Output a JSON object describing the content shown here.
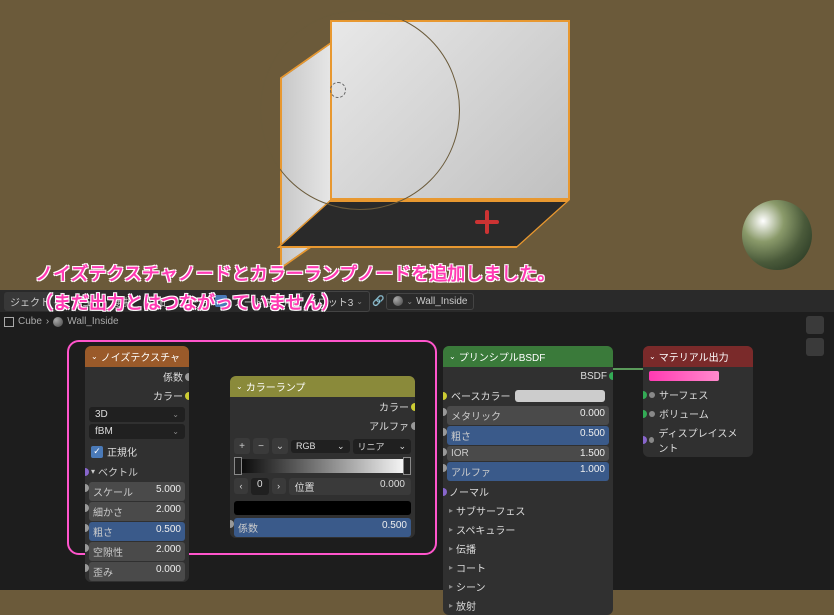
{
  "annotation": {
    "line1": "ノイズテクスチャノードとカラーランプノードを追加しました。",
    "line2": "（まだ出力とはつながっていません）"
  },
  "header": {
    "menu_object": "ジェクト",
    "menu_view": "ビュー",
    "menu_select": "選択",
    "menu_add": "追加",
    "menu_node": "ノード",
    "use_nodes": "ノードを使用",
    "slot": "スロット3",
    "material": "Wall_Inside"
  },
  "breadcrumb": {
    "object": "Cube",
    "material": "Wall_Inside"
  },
  "noise": {
    "title": "ノイズテクスチャ",
    "out_fac": "係数",
    "out_color": "カラー",
    "dim": "3D",
    "type": "fBM",
    "normalize": "正規化",
    "vector": "ベクトル",
    "scale_n": "スケール",
    "scale_v": "5.000",
    "detail_n": "細かさ",
    "detail_v": "2.000",
    "rough_n": "粗さ",
    "rough_v": "0.500",
    "lacun_n": "空隙性",
    "lacun_v": "2.000",
    "distort_n": "歪み",
    "distort_v": "0.000"
  },
  "ramp": {
    "title": "カラーランプ",
    "out_color": "カラー",
    "out_alpha": "アルファ",
    "interp": "RGB",
    "mode": "リニア",
    "index": "0",
    "pos_label": "位置",
    "pos_val": "0.000",
    "in_fac": "係数",
    "in_fac_val": "0.500"
  },
  "bsdf": {
    "title": "プリンシプルBSDF",
    "out": "BSDF",
    "base_color": "ベースカラー",
    "metallic_n": "メタリック",
    "metallic_v": "0.000",
    "rough_n": "粗さ",
    "rough_v": "0.500",
    "ior_n": "IOR",
    "ior_v": "1.500",
    "alpha_n": "アルファ",
    "alpha_v": "1.000",
    "normal": "ノーマル",
    "subsurface": "サブサーフェス",
    "specular": "スペキュラー",
    "transmission": "伝播",
    "coat": "コート",
    "sheen": "シーン",
    "emission": "放射"
  },
  "output": {
    "title": "マテリアル出力",
    "surface": "サーフェス",
    "volume": "ボリューム",
    "displacement": "ディスプレイスメント"
  },
  "chart_data": null
}
